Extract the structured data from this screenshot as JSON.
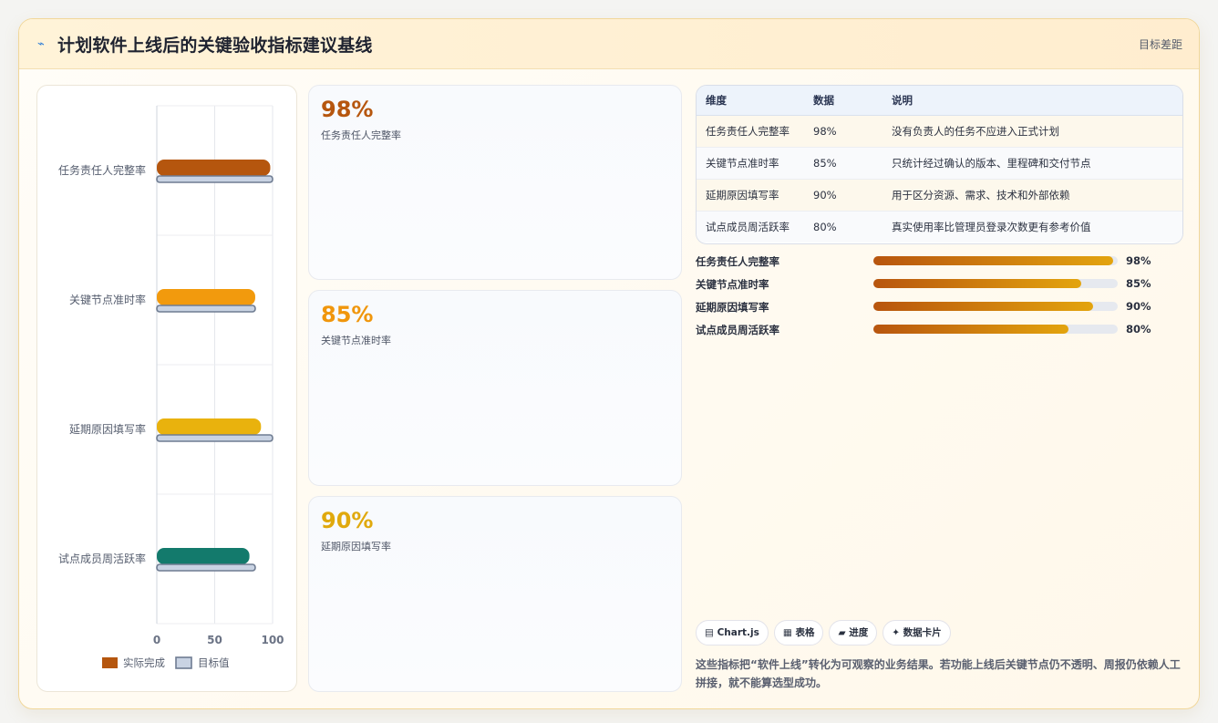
{
  "header": {
    "icon": "chart-trend-icon",
    "title": "计划软件上线后的关键验收指标建议基线",
    "right_link": "目标差距"
  },
  "chart_data": {
    "type": "bar",
    "orientation": "horizontal",
    "categories": [
      "任务责任人完整率",
      "关键节点准时率",
      "延期原因填写率",
      "试点成员周活跃率"
    ],
    "series": [
      {
        "name": "实际完成",
        "values": [
          98,
          85,
          90,
          80
        ],
        "colors": [
          "#b5560e",
          "#f29a0d",
          "#e9b20d",
          "#137a6c"
        ]
      },
      {
        "name": "目标值",
        "values": [
          100,
          85,
          100,
          85
        ],
        "color": "#c9d3e3"
      }
    ],
    "xlim": [
      0,
      100
    ],
    "xticks": [
      "0",
      "50",
      "100"
    ],
    "grid": true,
    "legend": "bottom"
  },
  "cards": [
    {
      "value": "98%",
      "label": "任务责任人完整率",
      "color": "#b6560e"
    },
    {
      "value": "85%",
      "label": "关键节点准时率",
      "color": "#f0960c"
    },
    {
      "value": "90%",
      "label": "延期原因填写率",
      "color": "#e0a90d"
    }
  ],
  "table": {
    "headers": [
      "维度",
      "数据",
      "说明"
    ],
    "rows": [
      {
        "dim": "任务责任人完整率",
        "val": "98%",
        "desc": "没有负责人的任务不应进入正式计划"
      },
      {
        "dim": "关键节点准时率",
        "val": "85%",
        "desc": "只统计经过确认的版本、里程碑和交付节点"
      },
      {
        "dim": "延期原因填写率",
        "val": "90%",
        "desc": "用于区分资源、需求、技术和外部依赖"
      },
      {
        "dim": "试点成员周活跃率",
        "val": "80%",
        "desc": "真实使用率比管理员登录次数更有参考价值"
      }
    ]
  },
  "progress": [
    {
      "label": "任务责任人完整率",
      "pct": 98,
      "text": "98%"
    },
    {
      "label": "关键节点准时率",
      "pct": 85,
      "text": "85%"
    },
    {
      "label": "延期原因填写率",
      "pct": 90,
      "text": "90%"
    },
    {
      "label": "试点成员周活跃率",
      "pct": 80,
      "text": "80%"
    }
  ],
  "chips": [
    {
      "icon": "chart-icon",
      "glyph": "▤",
      "label": "Chart.js"
    },
    {
      "icon": "table-icon",
      "glyph": "▦",
      "label": "表格"
    },
    {
      "icon": "progress-icon",
      "glyph": "▰",
      "label": "进度"
    },
    {
      "icon": "sparkle-icon",
      "glyph": "✦",
      "label": "数据卡片"
    }
  ],
  "note": "这些指标把“软件上线”转化为可观察的业务结果。若功能上线后关键节点仍不透明、周报仍依赖人工拼接，就不能算选型成功。"
}
